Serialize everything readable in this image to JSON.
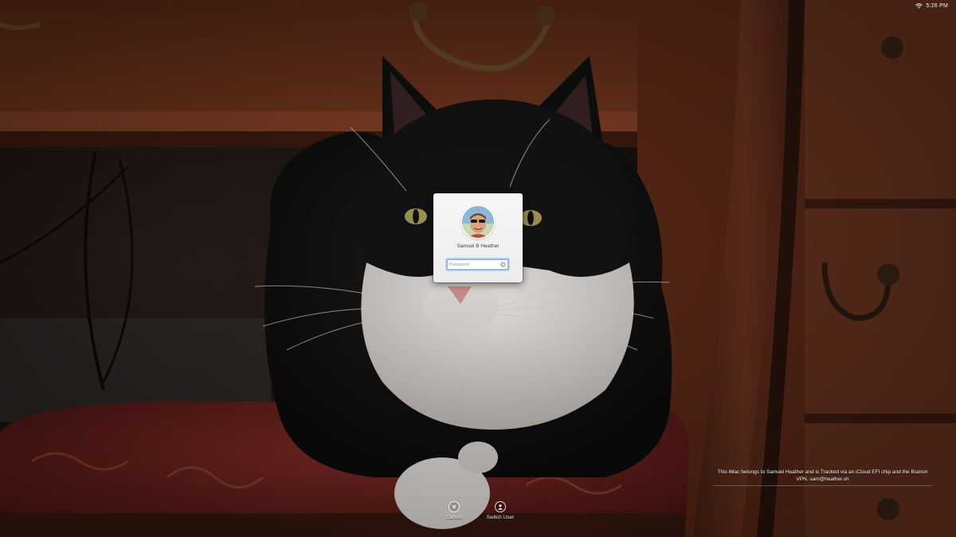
{
  "status_bar": {
    "time": "5:26 PM",
    "wifi_icon": "wifi-icon"
  },
  "login": {
    "user_name": "Samuel B Heather",
    "password_placeholder": "Password",
    "avatar_icon": "user-avatar",
    "submit_icon": "arrow-right-icon"
  },
  "message": {
    "text": "This iMac belongs to Samuel Heather and is Tracked via an iCloud EFI chip and the Branon VPN.  sam@heather.sh"
  },
  "buttons": {
    "cancel_label": "Cancel",
    "cancel_icon": "cancel-icon",
    "switch_user_label": "Switch User",
    "switch_user_icon": "switch-user-icon"
  },
  "colors": {
    "focus_ring": "#8fb4e8",
    "panel_bg": "#f2f2f2"
  }
}
